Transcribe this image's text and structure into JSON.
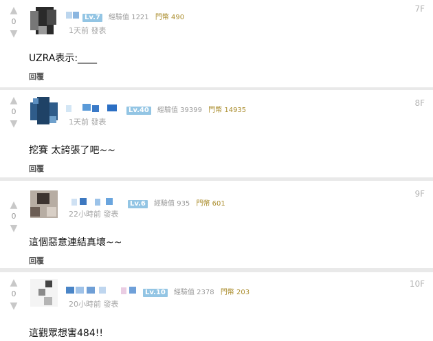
{
  "vote_up_icon": "arrow-up",
  "vote_down_icon": "arrow-down",
  "comments": [
    {
      "floor": "7F",
      "score": "0",
      "level": "Lv.7",
      "exp": "經驗值 1221",
      "coin": "門幣 490",
      "time": "1天前 發表",
      "text": "UZRA表示:____",
      "reply": "回覆"
    },
    {
      "floor": "8F",
      "score": "0",
      "level": "Lv.40",
      "exp": "經驗值 39399",
      "coin": "門幣 14935",
      "time": "1天前 發表",
      "text": "挖賽 太誇張了吧~~",
      "reply": "回覆"
    },
    {
      "floor": "9F",
      "score": "0",
      "level": "Lv.6",
      "exp": "經驗值 935",
      "coin": "門幣 601",
      "time": "22小時前 發表",
      "text": "這個惡意連結真壞~~",
      "reply": "回覆"
    },
    {
      "floor": "10F",
      "score": "0",
      "level": "Lv.10",
      "exp": "經驗值 2378",
      "coin": "門幣 203",
      "time": "20小時前 發表",
      "text": "這觀眾想害484!!",
      "reply": ""
    }
  ]
}
